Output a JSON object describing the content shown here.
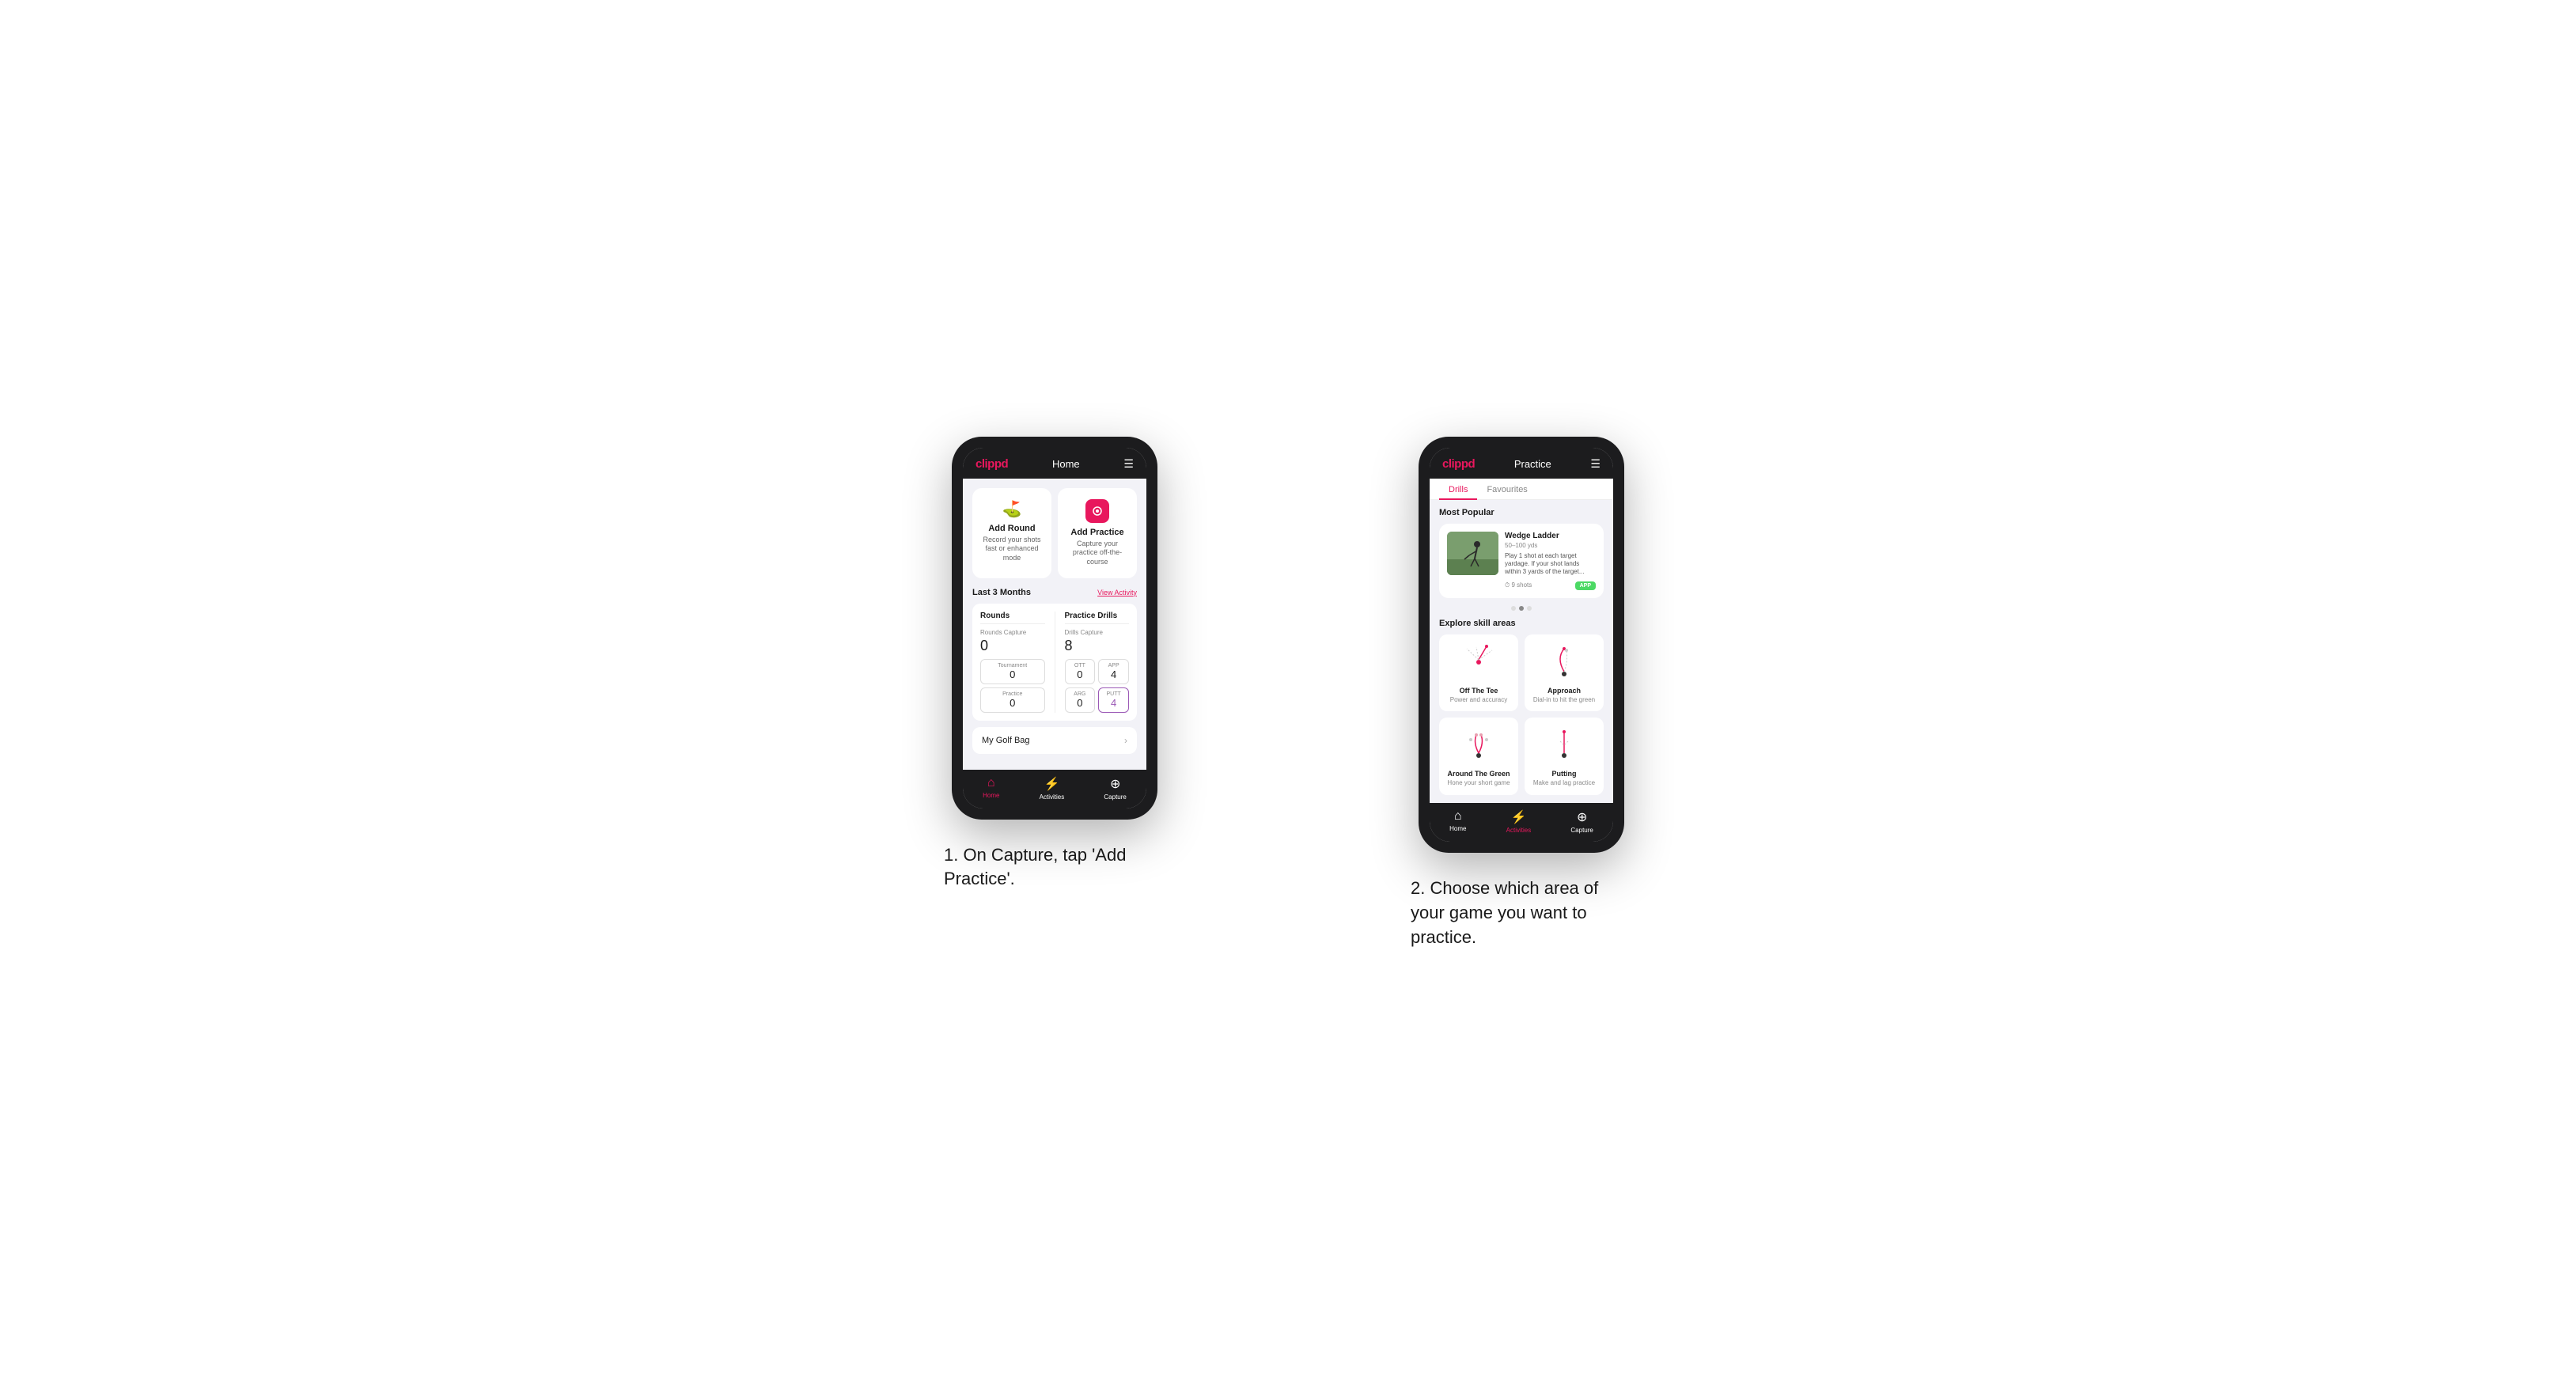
{
  "phone1": {
    "header": {
      "logo": "clippd",
      "title": "Home",
      "menu_icon": "☰"
    },
    "add_round": {
      "title": "Add Round",
      "desc": "Record your shots fast or enhanced mode"
    },
    "add_practice": {
      "title": "Add Practice",
      "desc": "Capture your practice off-the-course"
    },
    "stats_header": {
      "label": "Last 3 Months",
      "link": "View Activity"
    },
    "rounds": {
      "title": "Rounds",
      "capture_label": "Rounds Capture",
      "capture_value": "0",
      "tournament_label": "Tournament",
      "tournament_value": "0",
      "practice_label": "Practice",
      "practice_value": "0"
    },
    "practice_drills": {
      "title": "Practice Drills",
      "capture_label": "Drills Capture",
      "capture_value": "8",
      "ott_label": "OTT",
      "ott_value": "0",
      "app_label": "APP",
      "app_value": "4",
      "arg_label": "ARG",
      "arg_value": "0",
      "putt_label": "PUTT",
      "putt_value": "4"
    },
    "golf_bag": {
      "label": "My Golf Bag"
    },
    "nav": {
      "home": "Home",
      "activities": "Activities",
      "capture": "Capture"
    }
  },
  "phone2": {
    "header": {
      "logo": "clippd",
      "title": "Practice",
      "menu_icon": "☰"
    },
    "tabs": {
      "drills": "Drills",
      "favourites": "Favourites"
    },
    "most_popular": {
      "title": "Most Popular",
      "card": {
        "title": "Wedge Ladder",
        "subtitle": "50–100 yds",
        "desc": "Play 1 shot at each target yardage. If your shot lands within 3 yards of the target...",
        "shots": "9 shots",
        "badge": "APP"
      }
    },
    "explore": {
      "title": "Explore skill areas",
      "skills": [
        {
          "name": "Off The Tee",
          "desc": "Power and accuracy",
          "diagram_type": "tee"
        },
        {
          "name": "Approach",
          "desc": "Dial-in to hit the green",
          "diagram_type": "approach"
        },
        {
          "name": "Around The Green",
          "desc": "Hone your short game",
          "diagram_type": "atg"
        },
        {
          "name": "Putting",
          "desc": "Make and lag practice",
          "diagram_type": "putting"
        }
      ]
    },
    "nav": {
      "home": "Home",
      "activities": "Activities",
      "capture": "Capture"
    }
  },
  "captions": {
    "caption1": "1. On Capture, tap 'Add Practice'.",
    "caption2": "2. Choose which area of your game you want to practice."
  }
}
